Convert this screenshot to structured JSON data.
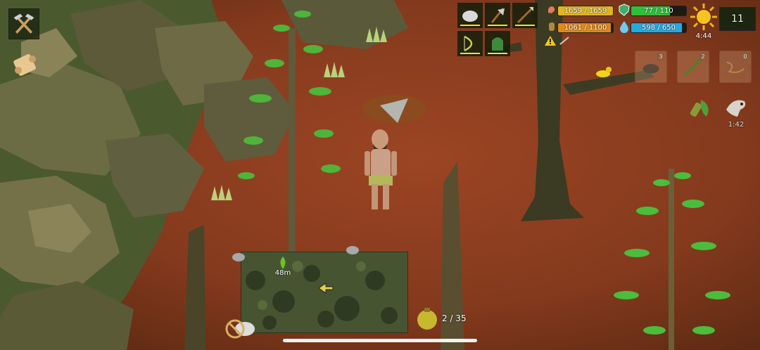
{
  "stats": {
    "health_text": "1659 / 1659",
    "health_fraction": 1.0,
    "food_text": "1061 / 1100",
    "food_fraction": 0.96,
    "armor_text": "77 / 110",
    "armor_fraction": 0.7,
    "water_text": "598 / 650",
    "water_fraction": 0.92
  },
  "time": {
    "clock": "4:44",
    "day_counter": "11",
    "effect_timer": "1:42"
  },
  "inventory": {
    "rock_count": "3",
    "stick_count": "2",
    "fiber_count": "0"
  },
  "minimap": {
    "distance": "48m"
  },
  "bag": {
    "capacity": "2 / 35"
  },
  "colors": {
    "health": "#e2b41c",
    "food": "#e08a1a",
    "armor": "#2fbf3a",
    "water": "#27a9e0",
    "ground": "#8a3e20"
  },
  "icons": {
    "craft": "crafting-pick-axe-icon",
    "scroll": "recipe-scroll-icon",
    "sun": "sun-icon",
    "warning": "warning-icon",
    "bag": "bag-icon",
    "no_hunt": "no-hunting-icon"
  }
}
